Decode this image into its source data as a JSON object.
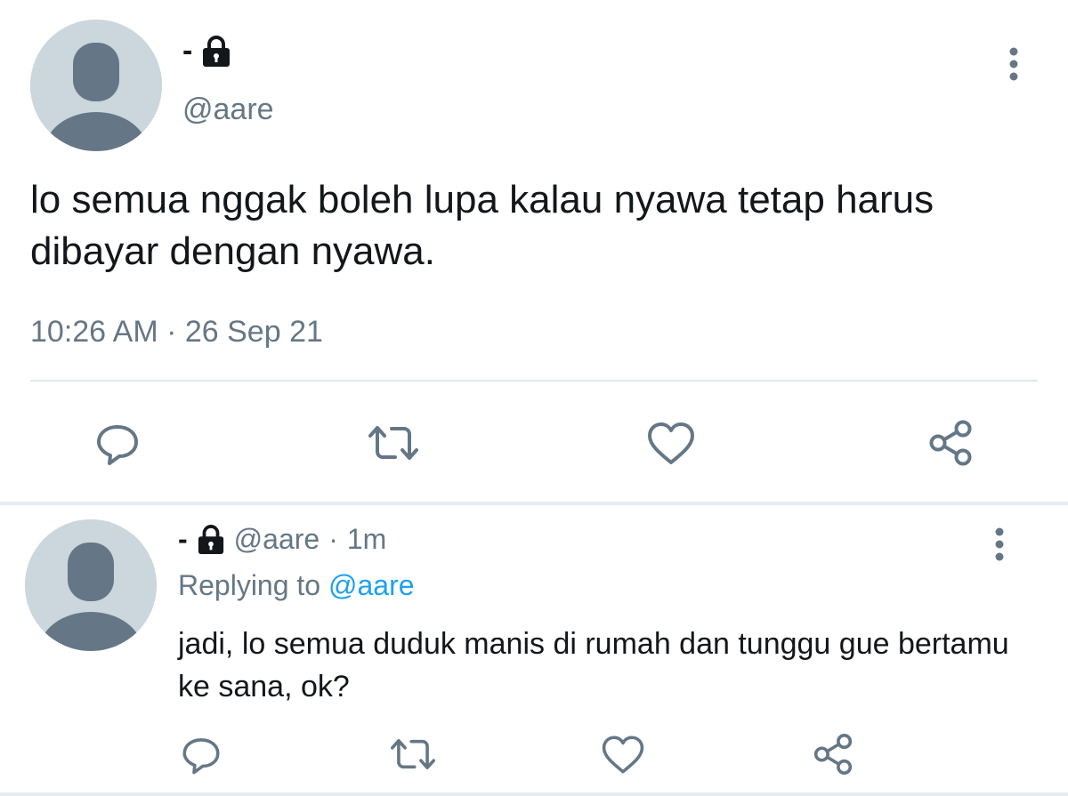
{
  "main_tweet": {
    "display_name": "-",
    "handle": "@aare",
    "text": "lo semua nggak boleh lupa kalau nyawa tetap harus dibayar dengan nyawa.",
    "timestamp": "10:26 AM · 26 Sep 21",
    "icons": [
      "lock-icon",
      "more-icon",
      "reply-icon",
      "retweet-icon",
      "like-icon",
      "share-icon"
    ]
  },
  "reply_tweet": {
    "display_name": "-",
    "handle": "@aare",
    "separator": "·",
    "time": "1m",
    "replying_label": "Replying to",
    "replying_to": "@aare",
    "text": "jadi, lo semua duduk manis di rumah dan tunggu gue bertamu ke sana, ok?",
    "icons": [
      "lock-icon",
      "more-icon",
      "reply-icon",
      "retweet-icon",
      "like-icon",
      "share-icon"
    ]
  },
  "colors": {
    "text": "#14171a",
    "secondary": "#657786",
    "link": "#1da1f2",
    "divider": "#e1e8ed",
    "avatar_bg": "#ccd6dd",
    "avatar_fg": "#657786"
  }
}
